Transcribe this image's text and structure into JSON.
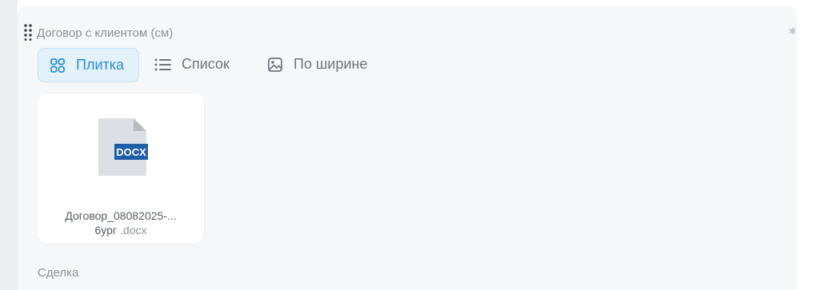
{
  "field": {
    "title": "Договор с клиентом (см)"
  },
  "view_tabs": {
    "tile_label": "Плитка",
    "list_label": "Список",
    "width_label": "По ширине",
    "active": "tile"
  },
  "files": [
    {
      "badge": "DOCX",
      "name_line1": "Договор_08082025-...",
      "name_line2": "6yрг",
      "extension": ".docx"
    }
  ],
  "next_section": {
    "label": "Сделка"
  },
  "colors": {
    "accent": "#2a8fd6",
    "accent_bg": "#e3f1fb",
    "panel_bg": "#f6f7f9",
    "muted_text": "#8a8f98",
    "doc_badge": "#1f5fa8"
  }
}
